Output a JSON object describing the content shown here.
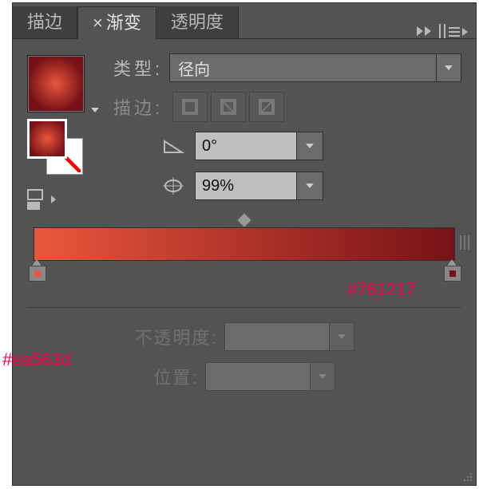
{
  "tabs": [
    "描边",
    "渐变",
    "透明度"
  ],
  "labels": {
    "type": "类型",
    "stroke": "描边",
    "opacity": "不透明度",
    "position": "位置"
  },
  "values": {
    "type": "径向",
    "angle": "0°",
    "aspect": "99%"
  },
  "gradient": {
    "stops": [
      {
        "color": "#ea563d",
        "position": 0
      },
      {
        "color": "#761217",
        "position": 100
      }
    ]
  },
  "annotations": {
    "left": "#ea563d",
    "right": "#761217"
  }
}
